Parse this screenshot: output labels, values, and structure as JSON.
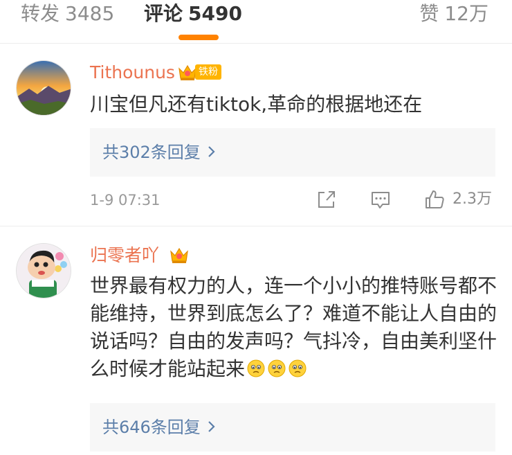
{
  "tabs": {
    "repost": {
      "label": "转发",
      "count": "3485"
    },
    "comments": {
      "label": "评论",
      "count": "5490"
    },
    "likes": {
      "label": "赞",
      "count": "12万"
    },
    "active": "comments",
    "accent_color": "#ff8200"
  },
  "comments": [
    {
      "username": "Tithounus",
      "badge_icon": "crown-icon",
      "badge_label": "铁粉",
      "text": "川宝但凡还有tiktok,革命的根据地还在",
      "replies_label": "共302条回复",
      "timestamp": "1-9 07:31",
      "like_count": "2.3万",
      "avatar": "sunset-landscape-avatar"
    },
    {
      "username": "归零者吖",
      "badge_icon": "crown-icon",
      "text": "世界最有权力的人，连一个小小的推特账号都不能维持，世界到底怎么了？难道不能让人自由的说话吗？自由的发声吗？气抖冷，自由美利坚什么时候才能站起来",
      "emojis": [
        "sad-face-emoji",
        "sad-face-emoji",
        "sad-face-emoji"
      ],
      "replies_label": "共646条回复",
      "avatar": "cartoon-boy-avatar"
    }
  ],
  "colors": {
    "username": "#eb7350",
    "link": "#5b7ea9",
    "badge": "#ffb400"
  }
}
